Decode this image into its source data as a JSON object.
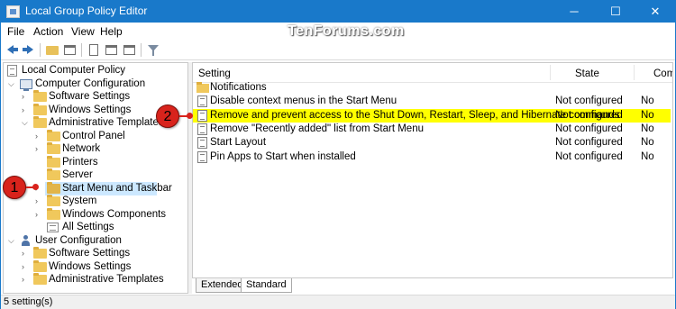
{
  "window": {
    "title": "Local Group Policy Editor",
    "controls": {
      "minimize": "─",
      "maximize": "☐",
      "close": "✕"
    }
  },
  "menu": [
    "File",
    "Action",
    "View",
    "Help"
  ],
  "watermark": "TenForums.com",
  "toolbar": {
    "icons": [
      "back-arrow-icon",
      "forward-arrow-icon",
      "up-folder-icon",
      "show-hide-tree-icon",
      "properties-icon",
      "help-icon",
      "filter-icon"
    ]
  },
  "tree": {
    "root": "Local Computer Policy",
    "computer_config": "Computer Configuration",
    "software_settings": "Software Settings",
    "windows_settings": "Windows Settings",
    "admin_templates": "Administrative Templates",
    "control_panel": "Control Panel",
    "network": "Network",
    "printers": "Printers",
    "server": "Server",
    "start_menu": "Start Menu and Taskbar",
    "system": "System",
    "windows_components": "Windows Components",
    "all_settings": "All Settings",
    "user_config": "User Configuration",
    "user_software_settings": "Software Settings",
    "user_windows_settings": "Windows Settings",
    "user_admin_templates": "Administrative Templates"
  },
  "list": {
    "headers": {
      "setting": "Setting",
      "state": "State",
      "comment": "Comment"
    },
    "rows": [
      {
        "name": "Notifications",
        "state": "",
        "comment": "",
        "type": "folder"
      },
      {
        "name": "Disable context menus in the Start Menu",
        "state": "Not configured",
        "comment": "No",
        "type": "policy"
      },
      {
        "name": "Remove and prevent access to the Shut Down, Restart, Sleep, and Hibernate commands",
        "state": "Not configured",
        "comment": "No",
        "type": "policy",
        "highlighted": true
      },
      {
        "name": "Remove \"Recently added\" list from Start Menu",
        "state": "Not configured",
        "comment": "No",
        "type": "policy"
      },
      {
        "name": "Start Layout",
        "state": "Not configured",
        "comment": "No",
        "type": "policy"
      },
      {
        "name": "Pin Apps to Start when installed",
        "state": "Not configured",
        "comment": "No",
        "type": "policy"
      }
    ]
  },
  "tabs": [
    "Extended",
    "Standard"
  ],
  "status": "5 setting(s)",
  "callouts": [
    "1",
    "2"
  ],
  "colors": {
    "titlebar": "#1979ca",
    "highlight": "#ffff00",
    "selection": "#cce8ff",
    "callout": "#d8231c"
  }
}
